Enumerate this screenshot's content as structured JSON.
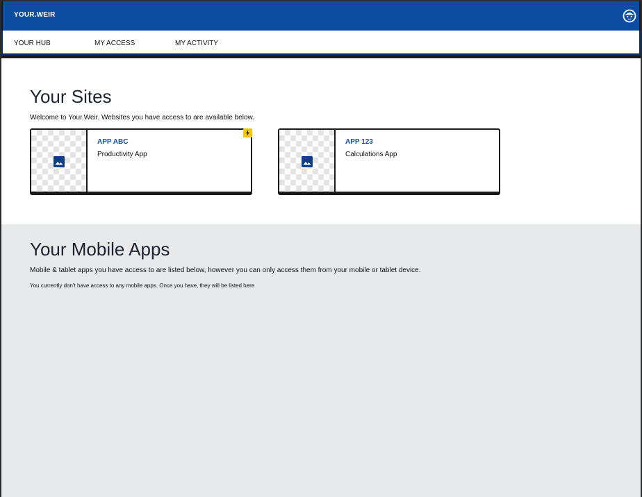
{
  "header": {
    "brand": "YOUR.WEIR",
    "avatar_icon": "user-face-icon"
  },
  "nav": {
    "items": [
      {
        "label": "YOUR HUB"
      },
      {
        "label": "MY ACCESS"
      },
      {
        "label": "MY ACTIVITY"
      }
    ]
  },
  "sites": {
    "title": "Your Sites",
    "description": "Welcome to Your.Weir. Websites you have access to are available below.",
    "cards": [
      {
        "title": "APP ABC",
        "subtitle": "Productivity App",
        "thumbnail_icon": "image-icon",
        "badge_icon": "lightning-bolt-icon"
      },
      {
        "title": "APP 123",
        "subtitle": "Calculations App",
        "thumbnail_icon": "image-icon"
      }
    ]
  },
  "mobile": {
    "title": "Your Mobile Apps",
    "description": "Mobile & tablet apps you have access to are listed below, however you can only access them from your mobile or tablet device.",
    "empty_note": "You currently don't have access to any mobile apps. Once you have, they will be listed here"
  },
  "colors": {
    "brand_blue": "#0c4da2",
    "nav_border": "#0a2f66",
    "badge_yellow": "#f5c518",
    "mobile_bg": "#e8e9eb"
  }
}
